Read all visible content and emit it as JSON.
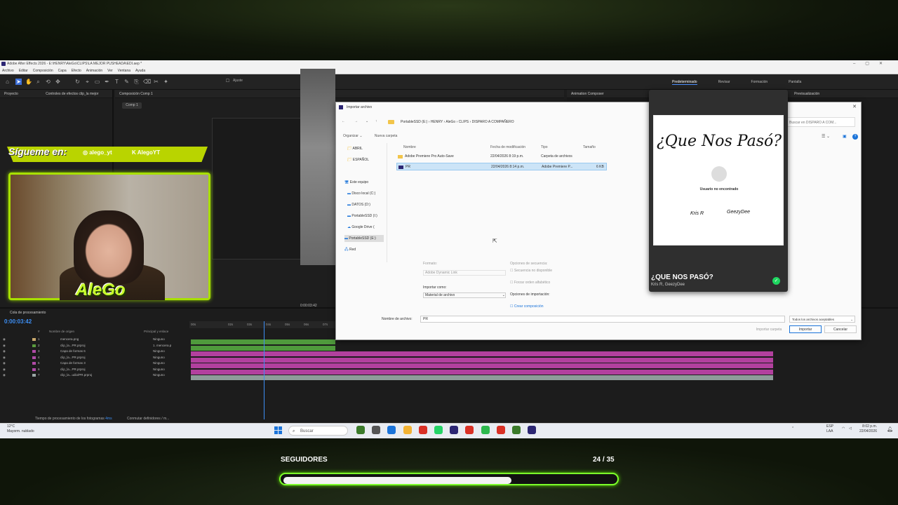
{
  "ae": {
    "title": "Adobe After Effects 2026 - E:\\HENRY\\AleGo\\CLIPS\\LA MEJOR PUSHEADA\\EDI.aep *",
    "menu": [
      "Archivo",
      "Editar",
      "Composición",
      "Capa",
      "Efecto",
      "Animación",
      "Ver",
      "Ventana",
      "Ayuda"
    ],
    "toolbar": {
      "snap_label": "Ajuste"
    },
    "workspaces": [
      "Predeterminado",
      "Revisar",
      "Formación",
      "Pantalla pequeña",
      "Estándar",
      "Bibliotecas"
    ],
    "panels": {
      "project": "Proyecto",
      "effect_controls": "Controles de efectos clip_la mejor",
      "composition": "Composición Comp 1",
      "comp_tab": "Comp 1",
      "animation_composer": "Animation Composer",
      "preview": "Previsualización"
    },
    "timeline": {
      "tab": "Cola de procesamiento",
      "current_time": "0:00:03:42",
      "viewer_time": "0:00:03:42",
      "ruler_marks": [
        "00s",
        "02s",
        "03s",
        "04s",
        "05s",
        "06s",
        "07s"
      ],
      "headers": {
        "num": "#",
        "name": "Nombre de origen",
        "parent": "Principal y enlace"
      },
      "layers": [
        {
          "num": "1",
          "name": "mencera.png",
          "parent": "Ninguno",
          "color": "#c9a86c"
        },
        {
          "num": "2",
          "name": "clip_la...PR.prproj",
          "parent": "1. mencera.p",
          "color": "#5a9a3e"
        },
        {
          "num": "3",
          "name": "Capa de formas 6",
          "parent": "Ninguno",
          "color": "#b04aa6"
        },
        {
          "num": "4",
          "name": "clip_la...PR.prproj",
          "parent": "Ninguno",
          "color": "#b04aa6"
        },
        {
          "num": "5",
          "name": "Capa de formas 3",
          "parent": "Ninguno",
          "color": "#b04aa6"
        },
        {
          "num": "6",
          "name": "clip_la...PR.prproj",
          "parent": "Ninguno",
          "color": "#b04aa6"
        },
        {
          "num": "7",
          "name": "clip_la...udio/PR.prproj",
          "parent": "Ninguno",
          "color": "#9aa8a6"
        }
      ],
      "status": "Tiempo de procesamiento de los fotogramas",
      "status_value": "4ms",
      "toggle": "Conmutar definidores / m..."
    },
    "track_colors": [
      "#4f9a3c",
      "#4f9a3c",
      "#b2409e",
      "#b2409e",
      "#b2409e",
      "#b2409e",
      "#8e9c9a"
    ]
  },
  "webcam": {
    "banner": "Sígueme en:",
    "handle_instagram": "alego_yt",
    "handle_kick": "AlegoYT",
    "logo": "AleGo"
  },
  "dialog": {
    "title": "Importar archivo",
    "path": [
      "PortableSSD (E:)",
      "HENRY",
      "AleGo",
      "CLIPS",
      "DISPARO A COMPAÑERO"
    ],
    "search_placeholder": "Buscar en DISPARO A COM...",
    "organize": "Organizar",
    "new_folder": "Nueva carpeta",
    "tree": [
      "ABRIL",
      "ESPAÑOL",
      "Este equipo",
      "Disco local (C:)",
      "DATOS (D:)",
      "PortableSSD (I:)",
      "Google Drive (",
      "PortableSSD (E:)",
      "Red"
    ],
    "columns": {
      "name": "Nombre",
      "date": "Fecha de modificación",
      "type": "Tipo",
      "size": "Tamaño"
    },
    "files": [
      {
        "name": "Adobe Premiere Pro Auto-Save",
        "date": "22/04/2026 8:19 p.m.",
        "type": "Carpeta de archivos",
        "size": ""
      },
      {
        "name": "PR",
        "date": "22/04/2026 8:14 p.m.",
        "type": "Adobe Premiere P...",
        "size": "6 KB"
      }
    ],
    "options": {
      "format_label": "Formato:",
      "format_value": "Adobe Dynamic Link",
      "seq_label": "Opciones de secuencia:",
      "seq_na": "Secuencia no disponible",
      "alpha": "Forzar orden alfabético",
      "import_as_label": "Importar como:",
      "import_as_value": "Material de archivo",
      "import_options": "Opciones de importación:",
      "create_comp": "Crear composición"
    },
    "filename_label": "Nombre de archivo:",
    "filename": "PR",
    "filetype": "Todos los archivos aceptables",
    "btn_import_folder": "Importar carpeta",
    "btn_import": "Importar",
    "btn_cancel": "Cancelar"
  },
  "song": {
    "art_title": "¿Que Nos Pasó?",
    "art_user": "Usuario no encontrado",
    "art_sig1": "Kris R",
    "art_sig2": "GeezyDee",
    "title": "¿QUE NOS PASÓ?",
    "artist": "Kris R, GeezyDee"
  },
  "taskbar": {
    "weather_temp": "12°C",
    "weather_desc": "Mayorm. nublado",
    "search": "Buscar",
    "lang1": "ESP",
    "lang2": "LAA",
    "time": "8:02 p.m.",
    "date": "22/04/2026",
    "app_colors": [
      "#3b7a2a",
      "#555",
      "#1a73d9",
      "#f2b233",
      "#d93025",
      "#25d366",
      "#2c2673",
      "#d93025",
      "#2db84d",
      "#d93025",
      "#3b7a2a",
      "#2c2673"
    ]
  },
  "followers": {
    "label": "SEGUIDORES",
    "count": "24 / 35",
    "progress": 0.686
  }
}
